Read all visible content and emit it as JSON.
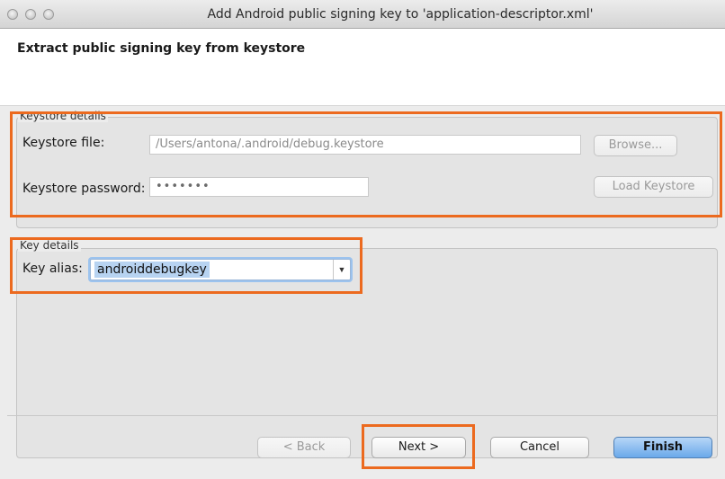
{
  "window": {
    "title": "Add Android public signing key to 'application-descriptor.xml'"
  },
  "header": {
    "title": "Extract public signing key from keystore"
  },
  "keystore_details": {
    "legend": "Keystore details",
    "file_label": "Keystore file:",
    "file_value": "/Users/antona/.android/debug.keystore",
    "password_label": "Keystore password:",
    "password_value": "•••••••",
    "browse_label": "Browse...",
    "load_label": "Load Keystore"
  },
  "key_details": {
    "legend": "Key details",
    "alias_label": "Key alias:",
    "alias_value": "androiddebugkey"
  },
  "buttons": {
    "back_label": "< Back",
    "next_label": "Next >",
    "cancel_label": "Cancel",
    "finish_label": "Finish"
  },
  "colors": {
    "highlight": "#ec6a1f",
    "finish_accent": "#6aa9ea"
  },
  "icons": {
    "dropdown": "chevron-down-icon"
  }
}
